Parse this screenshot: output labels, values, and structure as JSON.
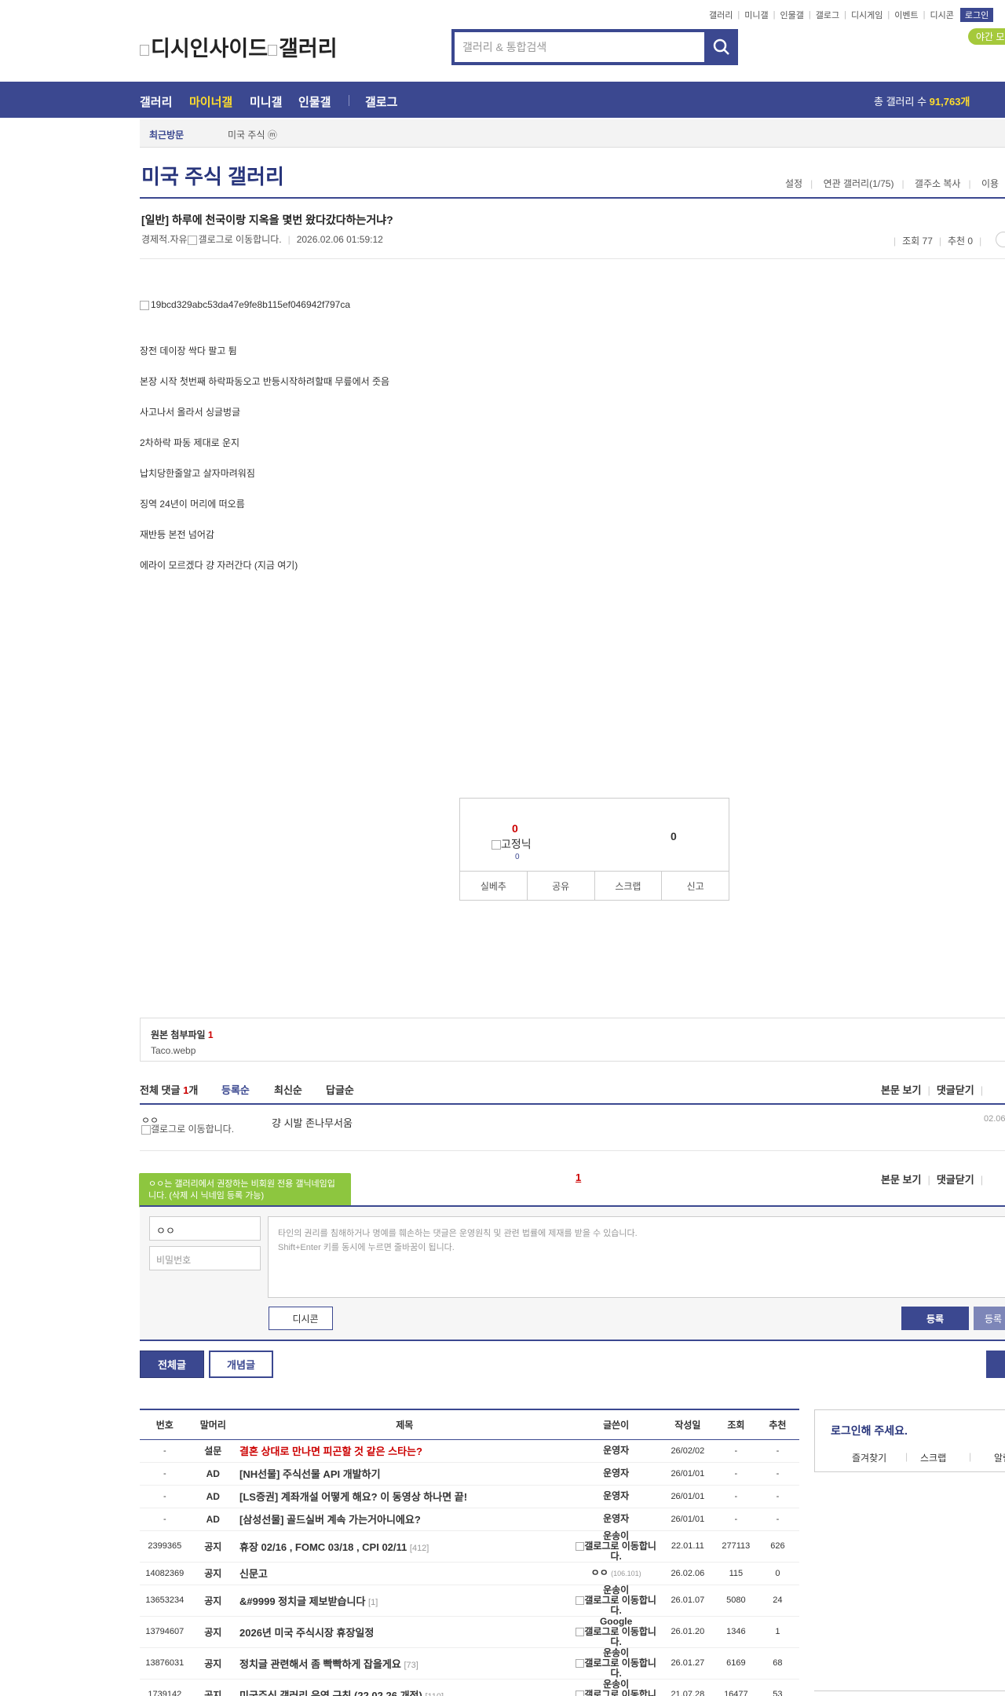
{
  "util_menu": [
    "갤러리",
    "미니갤",
    "인물갤",
    "갤로그",
    "디시게임",
    "이벤트",
    "디시콘"
  ],
  "login_label": "로그인",
  "night_mode": "야간 모드",
  "logo_alt": "디시인사이드",
  "logo_alt2": "갤러리",
  "search_placeholder": "갤러리 & 통합검색",
  "nav": {
    "items": [
      "갤러리",
      "마이너갤",
      "미니갤",
      "인물갤",
      "갤로그"
    ],
    "total_label": "총 갤러리 수",
    "total_value": "91,763개"
  },
  "recent": {
    "label": "최근방문",
    "item": "미국 주식 ⓜ"
  },
  "gallery_title": "미국 주식 갤러리",
  "gallery_menu": [
    "설정",
    "연관 갤러리(1/75)",
    "갤주소 복사",
    "이용"
  ],
  "post": {
    "title": "[일반] 하루에 천국이랑 지옥을 몇번 왔다갔다하는거냐?",
    "writer": "경제적.자유",
    "gallog_alt": "갤로그로 이동합니다.",
    "date": "2026.02.06 01:59:12",
    "views": "조회 77",
    "recommend": "추천 0",
    "image_alt": "19bcd329abc53da47e9fe8b115ef046942f797ca",
    "lines": [
      "장전 데이장 싹다 팔고 튐",
      "본장 시작 첫번째 하락파동오고 반등시작하려할때 무릎에서 줏음",
      "사고나서 올라서 싱글벙글",
      "2차하락 파동 제대로 운지",
      "납치당한줄알고 살자마려워짐",
      "징역 24년이 머리에 떠오름",
      "재반등 본전 넘어감",
      "에라이 모르겠다 걍 자러간다 (지금 여기)"
    ]
  },
  "rec_box": {
    "up": "0",
    "fixed_alt": "고정닉",
    "fixed_count": "0",
    "down": "0",
    "buttons": [
      "실베추",
      "공유",
      "스크랩",
      "신고"
    ]
  },
  "attach": {
    "title": "원본 첨부파일",
    "count": "1",
    "file": "Taco.webp"
  },
  "comments": {
    "total_label": "전체 댓글",
    "total_count": "1",
    "total_unit": "개",
    "tabs": [
      "등록순",
      "최신순",
      "답글순"
    ],
    "right": [
      "본문 보기",
      "댓글닫기"
    ],
    "items": [
      {
        "nick": "ㅇㅇ",
        "gallog_alt": "갤로그로 이동합니다.",
        "text": "걍 시발 존나무서움",
        "date": "02.06"
      }
    ],
    "page": "1",
    "tooltip": "ㅇㅇ는 갤러리에서 권장하는 비회원 전용 갤닉네임입니다. (삭제 시 닉네임 등록 가능)"
  },
  "write": {
    "nick": "ㅇㅇ",
    "pw_placeholder": "비밀번호",
    "textarea_line1": "타인의 권리를 침해하거나 명예를 훼손하는 댓글은 운영원칙 및 관련 법률에 제재를 받을 수 있습니다.",
    "textarea_line2": "Shift+Enter 키를 동시에 누르면 줄바꿈이 됩니다.",
    "dccon": "디시콘",
    "submit": "등록",
    "submit2": "등록"
  },
  "list_buttons": {
    "all": "전체글",
    "concept": "개념글"
  },
  "board": {
    "headers": [
      "번호",
      "말머리",
      "제목",
      "글쓴이",
      "작성일",
      "조회",
      "추천"
    ],
    "rows": [
      {
        "num": "-",
        "head": "설문",
        "subject": "결혼 상대로 만나면 피곤할 것 같은 스타는?",
        "count": "",
        "writer": "운영자",
        "date": "26/02/02",
        "views": "-",
        "rec": "-",
        "hot": true
      },
      {
        "num": "-",
        "head": "AD",
        "subject": "[NH선물] 주식선물 API 개발하기",
        "count": "",
        "writer": "운영자",
        "date": "26/01/01",
        "views": "-",
        "rec": "-"
      },
      {
        "num": "-",
        "head": "AD",
        "subject": "[LS증권] 계좌개설 어떻게 해요? 이 동영상 하나면 끝!",
        "count": "",
        "writer": "운영자",
        "date": "26/01/01",
        "views": "-",
        "rec": "-"
      },
      {
        "num": "-",
        "head": "AD",
        "subject": "[삼성선물] 골드실버 계속 가는거아니에요?",
        "count": "",
        "writer": "운영자",
        "date": "26/01/01",
        "views": "-",
        "rec": "-"
      },
      {
        "num": "2399365",
        "head": "공지",
        "subject": "휴장 02/16 , FOMC 03/18 , CPI 02/11",
        "count": "[412]",
        "writer": "운송이",
        "writer_alt": "갤로그로 이동합니다.",
        "date": "22.01.11",
        "views": "277113",
        "rec": "626"
      },
      {
        "num": "14082369",
        "head": "공지",
        "subject": "신문고",
        "count": "",
        "writer": "ㅇㅇ",
        "ip": "(106.101)",
        "date": "26.02.06",
        "views": "115",
        "rec": "0"
      },
      {
        "num": "13653234",
        "head": "공지",
        "subject": "&#9999 정치글 제보받습니다",
        "count": "[1]",
        "writer": "운송이",
        "writer_alt": "갤로그로 이동합니다.",
        "date": "26.01.07",
        "views": "5080",
        "rec": "24"
      },
      {
        "num": "13794607",
        "head": "공지",
        "subject": "2026년 미국 주식시장 휴장일정",
        "count": "",
        "writer": "Google",
        "writer_alt": "갤로그로 이동합니다.",
        "date": "26.01.20",
        "views": "1346",
        "rec": "1"
      },
      {
        "num": "13876031",
        "head": "공지",
        "subject": "정치글 관련해서 좀 빡빡하게 잡을게요",
        "count": "[73]",
        "writer": "운송이",
        "writer_alt": "갤로그로 이동합니다.",
        "date": "26.01.27",
        "views": "6169",
        "rec": "68"
      },
      {
        "num": "1739142",
        "head": "공지",
        "subject": "미국주식 갤러리 운영 규칙 (22.02.26 개정)",
        "count": "[110]",
        "writer": "운송이",
        "writer_alt": "갤로그로 이동합니다.",
        "date": "21.07.28",
        "views": "16477",
        "rec": "53"
      }
    ]
  },
  "loginbox": {
    "title": "로그인해 주세요.",
    "links": [
      "즐겨찾기",
      "스크랩",
      "알림"
    ]
  }
}
